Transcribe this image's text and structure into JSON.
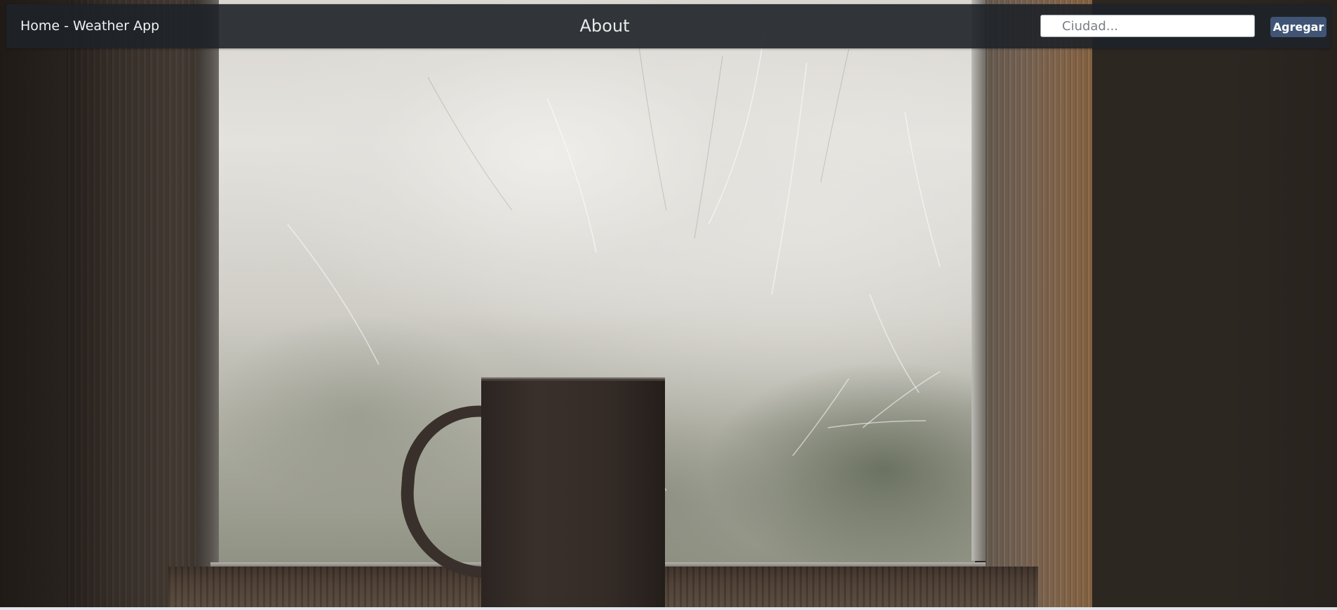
{
  "navbar": {
    "home_label": "Home - Weather App",
    "about_label": "About"
  },
  "search": {
    "placeholder": "Ciudad...",
    "value": "",
    "submit_label": "Agregar"
  },
  "colors": {
    "navbar_bg": "#1e2228",
    "button_bg": "#405575",
    "page_bg": "#2d2722"
  },
  "background": {
    "image_subject": "mug-on-window-sill"
  }
}
